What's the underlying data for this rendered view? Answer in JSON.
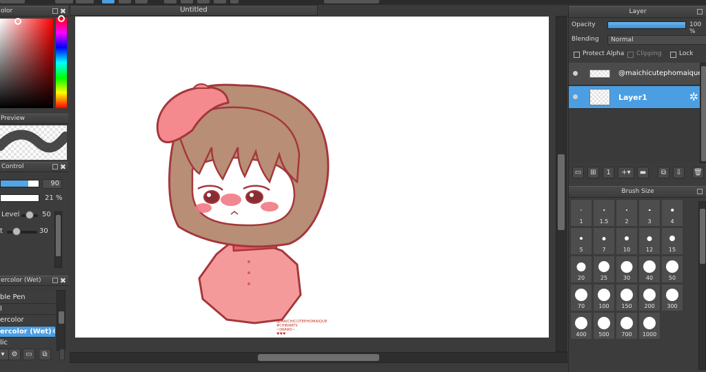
{
  "canvas": {
    "tab_title": "Untitled"
  },
  "color_panel": {
    "title": "olor"
  },
  "preview_panel": {
    "title": "Preview"
  },
  "control_panel": {
    "title": "Control",
    "size_value": "90",
    "opacity_value": "21",
    "opacity_unit": "%",
    "level_label": "Level",
    "level_value": "50",
    "t_label": "t",
    "t_value": "30"
  },
  "brush_panel": {
    "title": "ercolor (Wet)",
    "items": [
      {
        "label": "ble Pen"
      },
      {
        "label": "l"
      },
      {
        "label": "ercolor"
      },
      {
        "label": "ercolor (Wet)"
      },
      {
        "label": "lic"
      }
    ]
  },
  "layer_panel": {
    "title": "Layer",
    "opacity_label": "Opacity",
    "opacity_value": "100 %",
    "opacity_level": 1.0,
    "blending_label": "Blending",
    "blending_value": "Normal",
    "protect_alpha_label": "Protect Alpha",
    "clipping_label": "Clipping",
    "lock_label": "Lock",
    "layers": [
      {
        "name": "@maichicutephomaique",
        "selected": false
      },
      {
        "name": "Layer1",
        "selected": true
      }
    ]
  },
  "brush_size_panel": {
    "title": "Brush Size",
    "sizes": [
      "1",
      "1.5",
      "2",
      "3",
      "4",
      "5",
      "7",
      "10",
      "12",
      "15",
      "20",
      "25",
      "30",
      "40",
      "50",
      "70",
      "100",
      "150",
      "200",
      "300",
      "400",
      "500",
      "700",
      "1000"
    ]
  },
  "artwork": {
    "signature_lines": [
      "@MAICHICUTEPHOMAIQUE",
      "#CHIBIARTS",
      "~DRAWS~",
      "♥♥♥"
    ]
  },
  "colors": {
    "accent": "#4b9ee2",
    "panel_bg": "#3c3c3c",
    "hair": "#b48a72",
    "beret": "#f08a8a",
    "outline": "#a4373b"
  }
}
